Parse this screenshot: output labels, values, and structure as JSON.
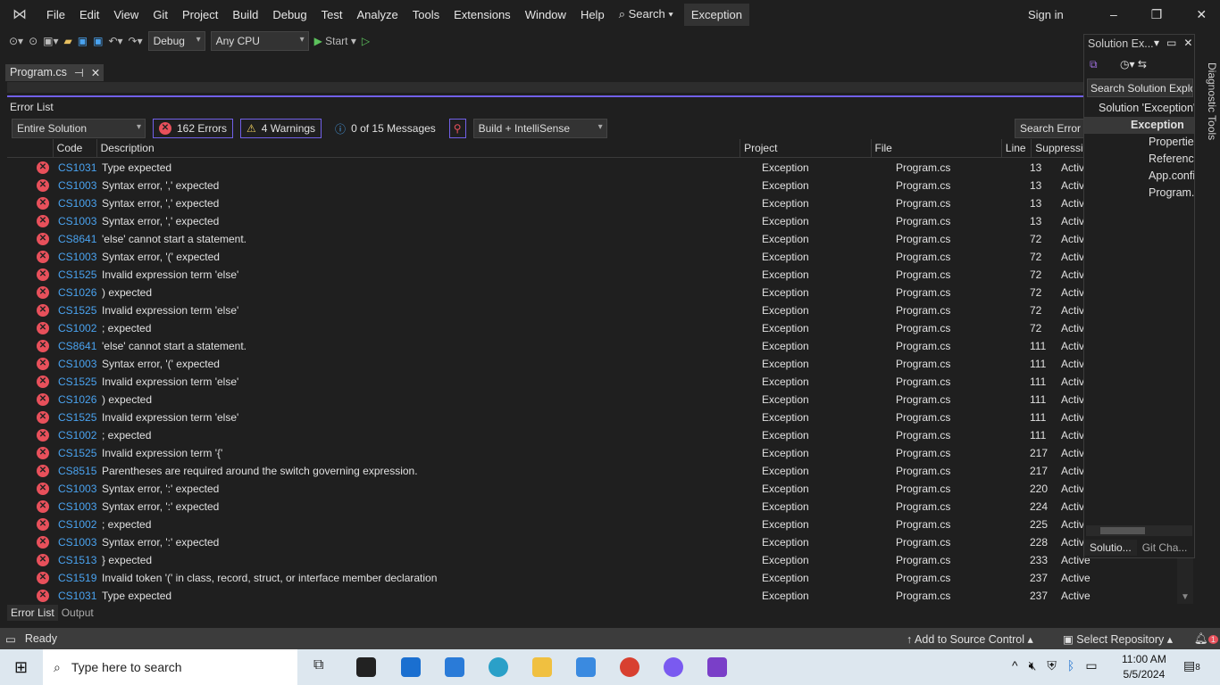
{
  "menu": [
    "File",
    "Edit",
    "View",
    "Git",
    "Project",
    "Build",
    "Debug",
    "Test",
    "Analyze",
    "Tools",
    "Extensions",
    "Window",
    "Help"
  ],
  "search_label": "Search",
  "solution_name": "Exception",
  "sign_in": "Sign in",
  "toolbar": {
    "config": "Debug",
    "platform": "Any CPU",
    "start": "Start"
  },
  "doc_tab": "Program.cs",
  "error_list": {
    "title": "Error List",
    "scope": "Entire Solution",
    "errors": "162 Errors",
    "warnings": "4 Warnings",
    "messages": "0 of 15 Messages",
    "source": "Build + IntelliSense",
    "search_placeholder": "Search Error List",
    "columns": [
      "Code",
      "Description",
      "Project",
      "File",
      "Line",
      "Suppression State"
    ],
    "rows": [
      [
        "CS1031",
        "Type expected",
        "13"
      ],
      [
        "CS1003",
        "Syntax error, ',' expected",
        "13"
      ],
      [
        "CS1003",
        "Syntax error, ',' expected",
        "13"
      ],
      [
        "CS1003",
        "Syntax error, ',' expected",
        "13"
      ],
      [
        "CS8641",
        "'else' cannot start a statement.",
        "72"
      ],
      [
        "CS1003",
        "Syntax error, '(' expected",
        "72"
      ],
      [
        "CS1525",
        "Invalid expression term 'else'",
        "72"
      ],
      [
        "CS1026",
        ") expected",
        "72"
      ],
      [
        "CS1525",
        "Invalid expression term 'else'",
        "72"
      ],
      [
        "CS1002",
        "; expected",
        "72"
      ],
      [
        "CS8641",
        "'else' cannot start a statement.",
        "111"
      ],
      [
        "CS1003",
        "Syntax error, '(' expected",
        "111"
      ],
      [
        "CS1525",
        "Invalid expression term 'else'",
        "111"
      ],
      [
        "CS1026",
        ") expected",
        "111"
      ],
      [
        "CS1525",
        "Invalid expression term 'else'",
        "111"
      ],
      [
        "CS1002",
        "; expected",
        "111"
      ],
      [
        "CS1525",
        "Invalid expression term '{'",
        "217"
      ],
      [
        "CS8515",
        "Parentheses are required around the switch governing expression.",
        "217"
      ],
      [
        "CS1003",
        "Syntax error, ':' expected",
        "220"
      ],
      [
        "CS1003",
        "Syntax error, ':' expected",
        "224"
      ],
      [
        "CS1002",
        "; expected",
        "225"
      ],
      [
        "CS1003",
        "Syntax error, ':' expected",
        "228"
      ],
      [
        "CS1513",
        "} expected",
        "233"
      ],
      [
        "CS1519",
        "Invalid token '(' in class, record, struct, or interface member declaration",
        "237"
      ],
      [
        "CS1031",
        "Type expected",
        "237"
      ]
    ],
    "project": "Exception",
    "file": "Program.cs",
    "state": "Active"
  },
  "bottom_tabs": [
    "Error List",
    "Output"
  ],
  "solution_explorer": {
    "title": "Solution Ex...",
    "search_placeholder": "Search Solution Explorer",
    "items": [
      "Solution 'Exception'",
      "Exception",
      "Properties",
      "References",
      "App.config",
      "Program.cs"
    ],
    "tabs": [
      "Solutio...",
      "Git Cha..."
    ]
  },
  "diagnostic_tools": "Diagnostic Tools",
  "status": {
    "ready": "Ready",
    "source_control": "Add to Source Control",
    "repo": "Select Repository",
    "notifications": "1"
  },
  "taskbar": {
    "search_placeholder": "Type here to search",
    "time": "11:00 AM",
    "date": "5/5/2024",
    "action_center_count": "8"
  },
  "colors": {
    "accent": "#7160e8",
    "error": "#e8505b",
    "code_link": "#4aa3f0"
  }
}
